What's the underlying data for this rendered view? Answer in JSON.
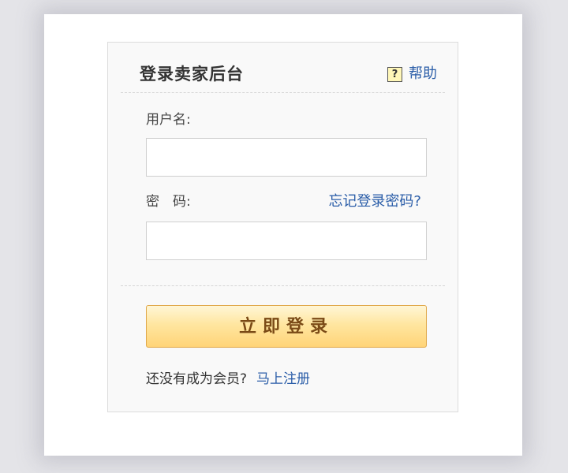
{
  "login": {
    "title": "登录卖家后台",
    "help": {
      "icon": "question-icon",
      "icon_glyph": "?",
      "label": "帮助"
    },
    "username": {
      "label": "用户名:",
      "value": ""
    },
    "password": {
      "label": "密　码:",
      "value": "",
      "forgot_link": "忘记登录密码?"
    },
    "submit_label": "立即登录",
    "register": {
      "prompt": "还没有成为会员?",
      "link": "马上注册"
    }
  },
  "colors": {
    "link": "#2a5da8",
    "button_text": "#7a4a16",
    "button_top": "#fff6d6",
    "button_bottom": "#ffd478",
    "panel_bg": "#f9f9f9"
  }
}
